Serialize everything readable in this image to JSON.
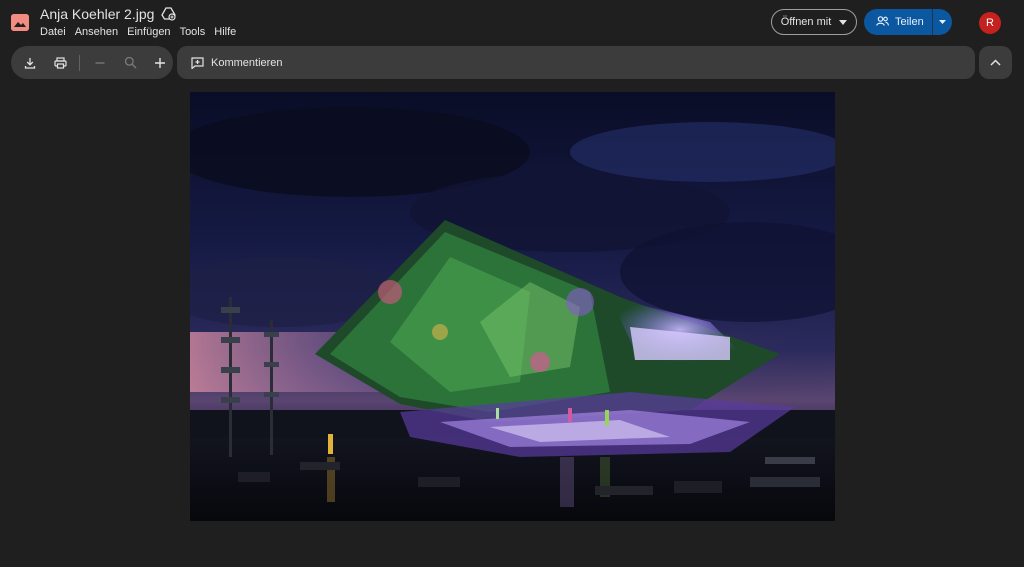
{
  "file": {
    "name": "Anja Koehler 2.jpg"
  },
  "menu": {
    "items": [
      "Datei",
      "Ansehen",
      "Einfügen",
      "Tools",
      "Hilfe"
    ]
  },
  "header": {
    "open_with_label": "Öffnen mit",
    "share_label": "Teilen",
    "avatar_initial": "R"
  },
  "toolbar": {
    "comment_label": "Kommentieren"
  },
  "icons": {
    "app": "image-icon",
    "drive": "add-to-drive-icon",
    "download": "download-icon",
    "print": "print-icon",
    "zoom_out": "minus-icon",
    "zoom_reset": "magnifier-icon",
    "zoom_in": "plus-icon",
    "comment": "add-comment-icon",
    "collapse": "chevron-up-icon"
  },
  "colors": {
    "background": "#1f1f1f",
    "toolbar": "#3c3c3c",
    "share": "#0b57a0",
    "avatar": "#c5221f",
    "app_icon": "#f28b82"
  }
}
